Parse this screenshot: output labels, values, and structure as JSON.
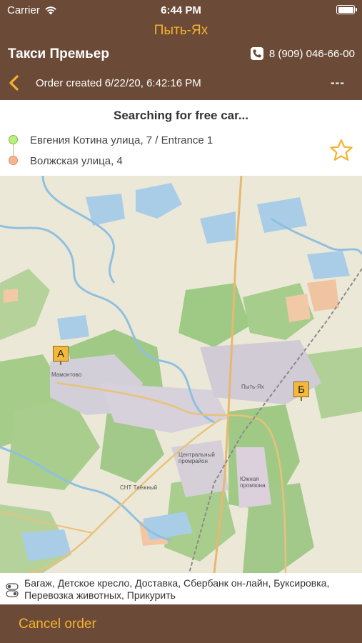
{
  "status_bar": {
    "carrier": "Carrier",
    "time": "6:44 PM"
  },
  "header": {
    "city": "Пыть-Ях",
    "company": "Такси Премьер",
    "phone": "8 (909) 046-66-00",
    "order_created": "Order created 6/22/20, 6:42:16 PM",
    "price": "---"
  },
  "route": {
    "status": "Searching for free car...",
    "from": "Евгения Котина улица, 7 / Entrance 1",
    "to": "Волжская улица, 4"
  },
  "map": {
    "marker_a": "А",
    "marker_b": "Б",
    "labels": {
      "mamontovo": "Мамонтово",
      "pyt_yakh": "Пыть-Ях",
      "central": "Центральный промрайон",
      "south": "Южная промзона",
      "snt": "СНТ Таёжный"
    }
  },
  "services": "Багаж, Детское кресло, Доставка, Сбербанк он-лайн, Буксировка, Перевозка животных, Прикурить",
  "actions": {
    "cancel": "Cancel order"
  },
  "colors": {
    "brown": "#6b4a37",
    "accent": "#f5b32f"
  }
}
